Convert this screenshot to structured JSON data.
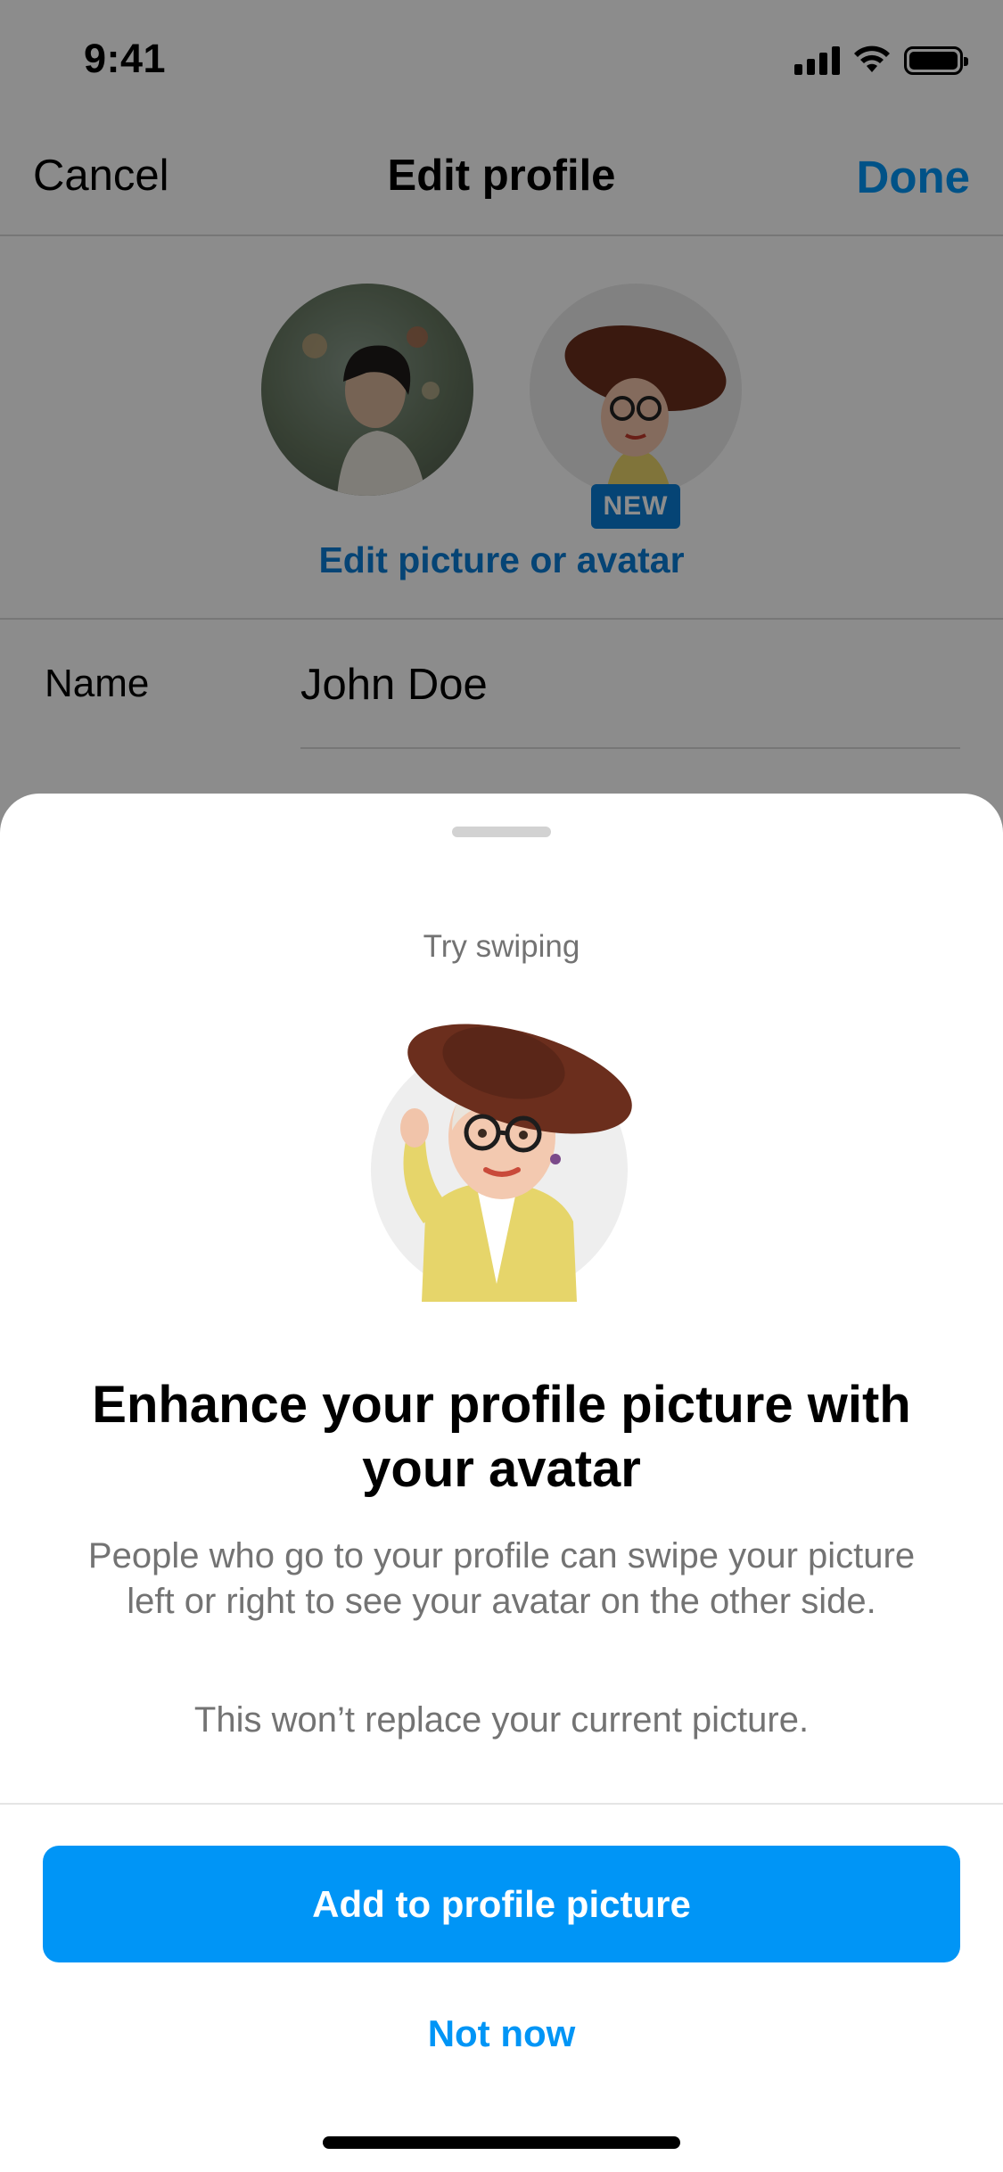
{
  "status_bar": {
    "time": "9:41",
    "icons": [
      "cellular-signal-icon",
      "wifi-icon",
      "battery-icon"
    ]
  },
  "nav": {
    "cancel_label": "Cancel",
    "title": "Edit profile",
    "done_label": "Done"
  },
  "profile": {
    "new_badge": "NEW",
    "edit_link": "Edit picture or avatar"
  },
  "fields": {
    "name_label": "Name",
    "name_value": "John Doe"
  },
  "sheet": {
    "eyebrow": "Try swiping",
    "title": "Enhance your profile picture with your avatar",
    "body": "People who go to your profile can swipe your picture left or right to see your avatar on the other side.",
    "note": "This won’t replace your current picture.",
    "primary_button": "Add to profile picture",
    "secondary_button": "Not now"
  },
  "colors": {
    "accent": "#0095f6",
    "link_dimmed": "#0a7cd5",
    "overlay": "rgba(0,0,0,0.45)"
  }
}
